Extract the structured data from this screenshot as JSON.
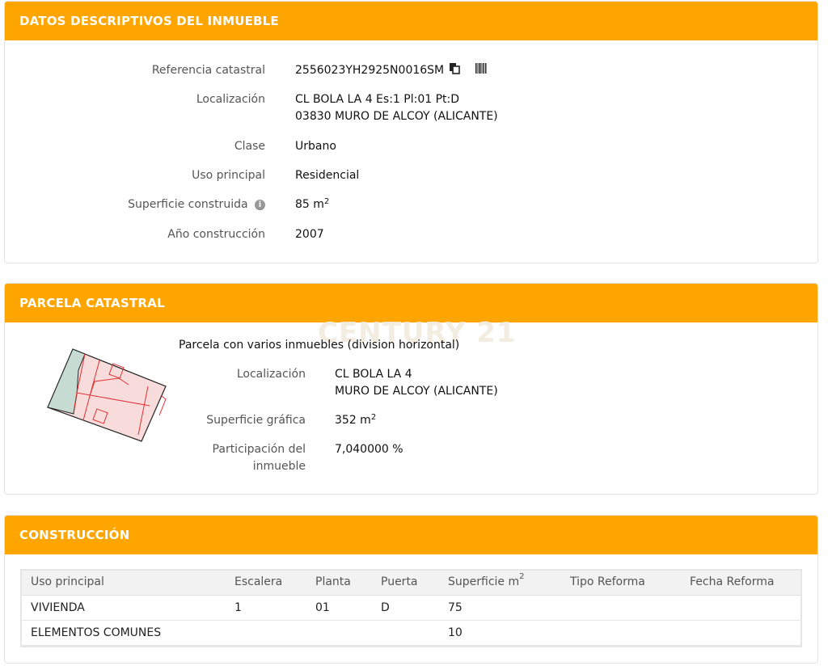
{
  "datos": {
    "header": "DATOS DESCRIPTIVOS DEL INMUEBLE",
    "ref_label": "Referencia catastral",
    "ref_value": "2556023YH2925N0016SM",
    "loc_label": "Localización",
    "loc_line1": "CL BOLA LA 4 Es:1 Pl:01 Pt:D",
    "loc_line2": "03830 MURO DE ALCOY (ALICANTE)",
    "clase_label": "Clase",
    "clase_value": "Urbano",
    "uso_label": "Uso principal",
    "uso_value": "Residencial",
    "sup_label": "Superficie construida",
    "sup_value": "85 m",
    "sup_exp": "2",
    "anio_label": "Año construcción",
    "anio_value": "2007"
  },
  "parcela": {
    "header": "PARCELA CATASTRAL",
    "watermark": "CENTURY 21",
    "title": "Parcela con varios inmuebles (division horizontal)",
    "loc_label": "Localización",
    "loc_line1": "CL BOLA LA 4",
    "loc_line2": "MURO DE ALCOY (ALICANTE)",
    "sup_label": "Superficie gráfica",
    "sup_value": "352 m",
    "sup_exp": "2",
    "part_label_1": "Participación del",
    "part_label_2": "inmueble",
    "part_value": "7,040000 %"
  },
  "construccion": {
    "header": "CONSTRUCCIÓN",
    "columns": [
      "Uso principal",
      "Escalera",
      "Planta",
      "Puerta",
      "Superficie m",
      "Tipo Reforma",
      "Fecha Reforma"
    ],
    "sup_col_exp": "2",
    "rows": [
      [
        "VIVIENDA",
        "1",
        "01",
        "D",
        "75",
        "",
        ""
      ],
      [
        "ELEMENTOS COMUNES",
        "",
        "",
        "",
        "10",
        "",
        ""
      ]
    ]
  },
  "icons": [
    "copy-icon",
    "barcode-icon",
    "info-icon"
  ],
  "colors": {
    "accent": "#ffa500",
    "header_text": "#ffffff"
  }
}
